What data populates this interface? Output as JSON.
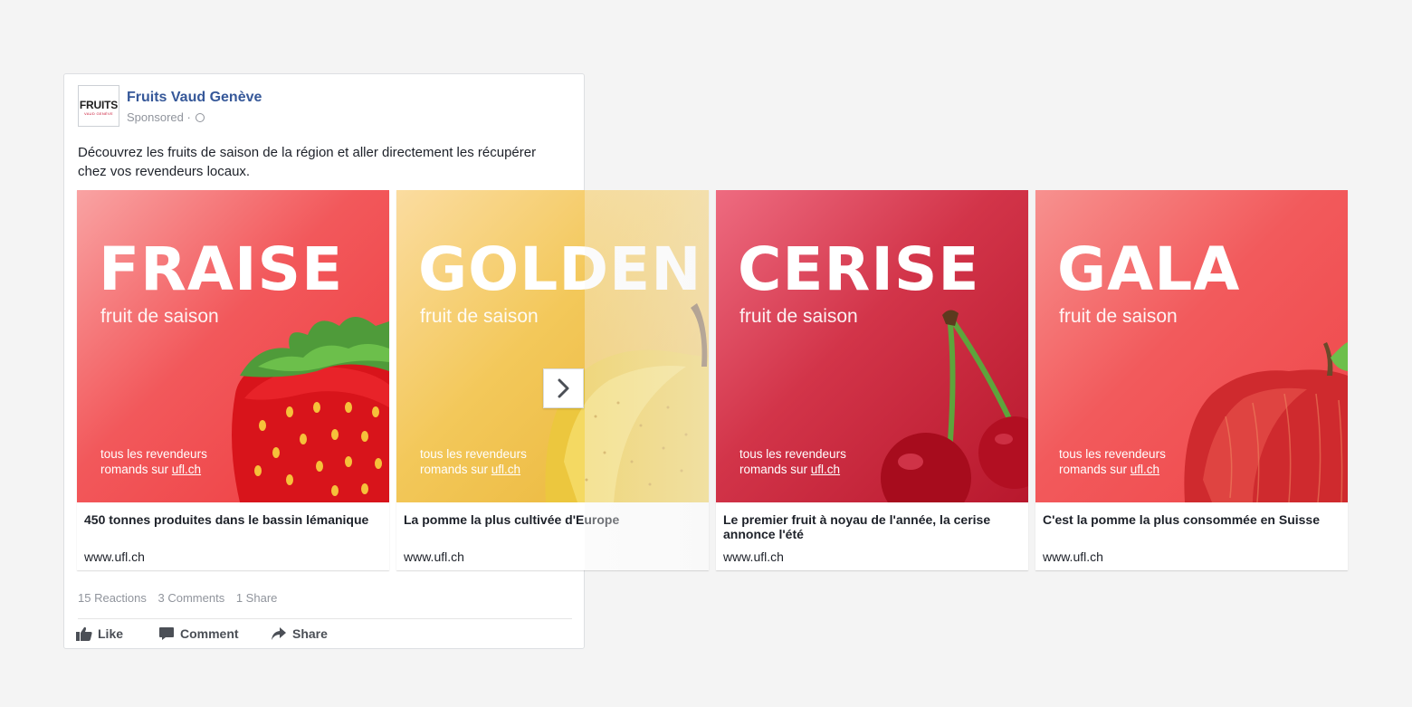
{
  "post": {
    "page_name": "Fruits Vaud Genève",
    "sponsored": "Sponsored ·",
    "logo_text": "FRUITS",
    "logo_sub": "VAUD GENÈVE",
    "text": "Découvrez les fruits de saison de la région et aller directement les récupérer chez vos revendeurs locaux.",
    "stats": {
      "reactions": "15 Reactions",
      "comments": "3 Comments",
      "shares": "1 Share"
    },
    "actions": {
      "like": "Like",
      "comment": "Comment",
      "share": "Share"
    }
  },
  "cards": [
    {
      "name": "FRAISE",
      "sub": "fruit de saison",
      "foot1": "tous les revendeurs",
      "foot2": "romands sur ",
      "link": "ufl.ch",
      "title": "450 tonnes produites dans le bassin lémanique",
      "url": "www.ufl.ch"
    },
    {
      "name": "GOLDEN",
      "sub": "fruit de saison",
      "foot1": "tous les revendeurs",
      "foot2": "romands sur ",
      "link": "ufl.ch",
      "title": "La pomme la plus cultivée d'Europe",
      "url": "www.ufl.ch"
    },
    {
      "name": "CERISE",
      "sub": "fruit de saison",
      "foot1": "tous les revendeurs",
      "foot2": "romands sur ",
      "link": "ufl.ch",
      "title": "Le premier fruit à noyau de l'année, la cerise annonce l'été",
      "url": "www.ufl.ch"
    },
    {
      "name": "GALA",
      "sub": "fruit de saison",
      "foot1": "tous les revendeurs",
      "foot2": "romands sur ",
      "link": "ufl.ch",
      "title": "C'est la pomme la plus consommée en Suisse",
      "url": "www.ufl.ch"
    }
  ],
  "colors": {
    "link_blue": "#365899",
    "fraise": "#f04a4f",
    "golden": "#f0c24e",
    "cerise": "#c8233e",
    "gala": "#f2565a"
  },
  "icons": [
    "thumbs-up-icon",
    "comment-icon",
    "share-arrow-icon",
    "chevron-right-icon",
    "globe-icon"
  ]
}
